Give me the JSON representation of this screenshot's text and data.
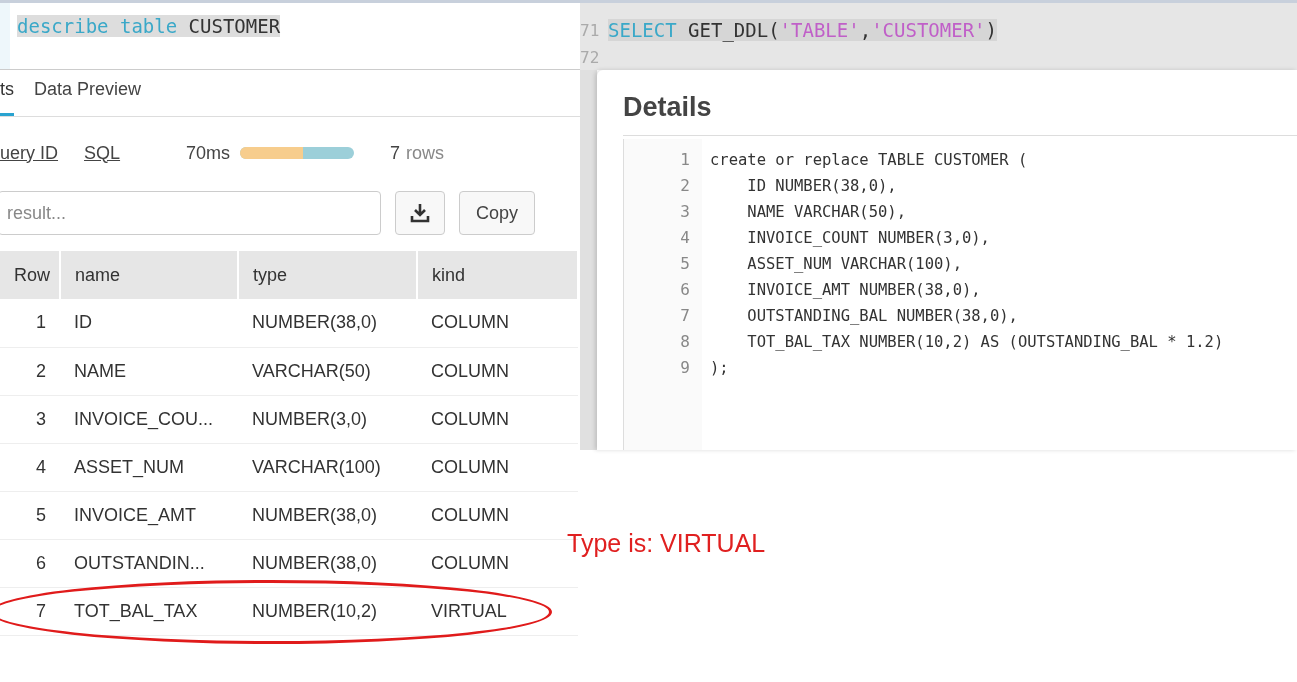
{
  "results_panel": {
    "editor": {
      "tokens": [
        {
          "text": "describe table",
          "kind": "keyword"
        },
        {
          "text": " CUSTOMER",
          "kind": "plain"
        }
      ]
    },
    "tabs": [
      {
        "label": "ts",
        "selected": true
      },
      {
        "label": "Data Preview",
        "selected": false
      }
    ],
    "toolbar": {
      "links": [
        "uery ID",
        "SQL"
      ],
      "duration": "70ms",
      "level": 0.55,
      "row_count": "7",
      "row_unit": "rows"
    },
    "search": {
      "placeholder": "result..."
    },
    "copy_button": "Copy",
    "table": {
      "columns": [
        "Row",
        "name",
        "type",
        "kind"
      ],
      "rows": [
        {
          "cells": [
            "1",
            "ID",
            "NUMBER(38,0)",
            "COLUMN"
          ],
          "highlighted": false
        },
        {
          "cells": [
            "2",
            "NAME",
            "VARCHAR(50)",
            "COLUMN"
          ],
          "highlighted": false
        },
        {
          "cells": [
            "3",
            "INVOICE_COU...",
            "NUMBER(3,0)",
            "COLUMN"
          ],
          "highlighted": false
        },
        {
          "cells": [
            "4",
            "ASSET_NUM",
            "VARCHAR(100)",
            "COLUMN"
          ],
          "highlighted": false
        },
        {
          "cells": [
            "5",
            "INVOICE_AMT",
            "NUMBER(38,0)",
            "COLUMN"
          ],
          "highlighted": false
        },
        {
          "cells": [
            "6",
            "OUTSTANDIN...",
            "NUMBER(38,0)",
            "COLUMN"
          ],
          "highlighted": false
        },
        {
          "cells": [
            "7",
            "TOT_BAL_TAX",
            "NUMBER(10,2)",
            "VIRTUAL"
          ],
          "highlighted": true
        }
      ]
    }
  },
  "ddl_panel": {
    "editor": {
      "line_numbers": [
        "71",
        "72"
      ],
      "tokens": [
        {
          "text": "SELECT",
          "kind": "keyword"
        },
        {
          "text": " GET_DDL(",
          "kind": "plain"
        },
        {
          "text": "'TABLE'",
          "kind": "string"
        },
        {
          "text": ",",
          "kind": "plain"
        },
        {
          "text": "'CUSTOMER'",
          "kind": "string"
        },
        {
          "text": ")",
          "kind": "plain"
        }
      ]
    },
    "dialog": {
      "title": "Details",
      "code": [
        {
          "number": "1",
          "text": "create or replace TABLE CUSTOMER ("
        },
        {
          "number": "2",
          "text": "    ID NUMBER(38,0),"
        },
        {
          "number": "3",
          "text": "    NAME VARCHAR(50),"
        },
        {
          "number": "4",
          "text": "    INVOICE_COUNT NUMBER(3,0),"
        },
        {
          "number": "5",
          "text": "    ASSET_NUM VARCHAR(100),"
        },
        {
          "number": "6",
          "text": "    INVOICE_AMT NUMBER(38,0),"
        },
        {
          "number": "7",
          "text": "    OUTSTANDING_BAL NUMBER(38,0),"
        },
        {
          "number": "8",
          "text": "    TOT_BAL_TAX NUMBER(10,2) AS (OUTSTANDING_BAL * 1.2)"
        },
        {
          "number": "9",
          "text": ");"
        }
      ]
    }
  },
  "annotation": {
    "text": "Type is: VIRTUAL"
  }
}
